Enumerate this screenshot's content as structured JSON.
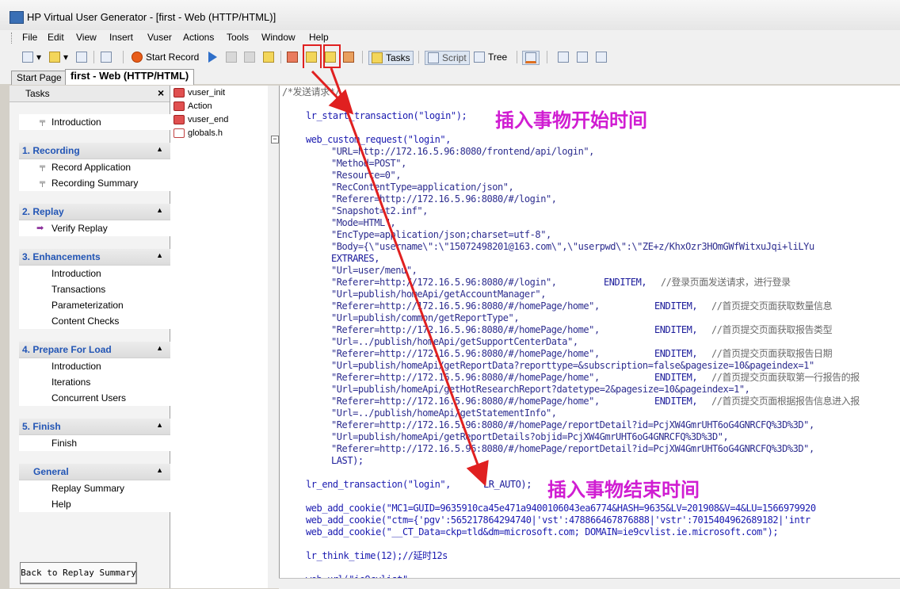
{
  "window": {
    "title": "HP Virtual User Generator - [first - Web (HTTP/HTML)]"
  },
  "menu": [
    "File",
    "Edit",
    "View",
    "Insert",
    "Vuser",
    "Actions",
    "Tools",
    "Window",
    "Help"
  ],
  "toolbar": {
    "start_record": "Start Record",
    "tasks": "Tasks",
    "script": "Script",
    "tree": "Tree"
  },
  "tabs": [
    "Start Page",
    "first - Web (HTTP/HTML)"
  ],
  "tasks_pane": {
    "title": "Tasks",
    "intro": "Introduction",
    "groups": [
      {
        "title": "1. Recording",
        "items": [
          "Record Application",
          "Recording Summary"
        ]
      },
      {
        "title": "2. Replay",
        "items": [
          "Verify Replay"
        ]
      },
      {
        "title": "3. Enhancements",
        "items": [
          "Introduction",
          "Transactions",
          "Parameterization",
          "Content Checks"
        ]
      },
      {
        "title": "4. Prepare For Load",
        "items": [
          "Introduction",
          "Iterations",
          "Concurrent Users"
        ]
      },
      {
        "title": "5. Finish",
        "items": [
          "Finish"
        ]
      },
      {
        "title": "General",
        "items": [
          "Replay Summary",
          "Help"
        ]
      }
    ],
    "back_button": "Back to Replay Summary"
  },
  "tree": [
    "vuser_init",
    "Action",
    "vuser_end",
    "globals.h"
  ],
  "code": {
    "l0": "/*发送请求*/",
    "l1": "lr_start_transaction(\"login\");",
    "l2": "web_custom_request(\"login\",",
    "l3": "\"URL=http://172.16.5.96:8080/frontend/api/login\",",
    "l4": "\"Method=POST\",",
    "l5": "\"Resource=0\",",
    "l6": "\"RecContentType=application/json\",",
    "l7": "\"Referer=http://172.16.5.96:8080/#/login\",",
    "l8": "\"Snapshot=t2.inf\",",
    "l9": "\"Mode=HTML\",",
    "l10": "\"EncType=application/json;charset=utf-8\",",
    "l11": "\"Body={\\\"username\\\":\\\"15072498201@163.com\\\",\\\"userpwd\\\":\\\"ZE+z/KhxOzr3HOmGWfWitxuJqi+liLYu",
    "l12": "EXTRARES,",
    "l13": "\"Url=user/menu\",",
    "l14a": "\"Referer=http://172.16.5.96:8080/#/login\",",
    "l14b": "ENDITEM,",
    "l14c": "//登录页面发送请求，进行登录",
    "l15": "\"Url=publish/homeApi/getAccountManager\",",
    "l16a": "\"Referer=http://172.16.5.96:8080/#/homePage/home\",",
    "l16b": "ENDITEM,",
    "l16c": "//首页提交页面获取数量信息",
    "l17": "\"Url=publish/common/getReportType\",",
    "l18a": "\"Referer=http://172.16.5.96:8080/#/homePage/home\",",
    "l18b": "ENDITEM,",
    "l18c": "//首页提交页面获取报告类型",
    "l19": "\"Url=../publish/homeApi/getSupportCenterData\",",
    "l20a": "\"Referer=http://172.16.5.96:8080/#/homePage/home\",",
    "l20b": "ENDITEM,",
    "l20c": "//首页提交页面获取报告日期",
    "l21": "\"Url=publish/homeApi/getReportData?reporttype=&subscription=false&pagesize=10&pageindex=1\"",
    "l22a": "\"Referer=http://172.16.5.96:8080/#/homePage/home\",",
    "l22b": "ENDITEM,",
    "l22c": "//首页提交页面获取第一行报告的报",
    "l23": "\"Url=publish/homeApi/getHotResearchReport?datetype=2&pagesize=10&pageindex=1\",",
    "l24a": "\"Referer=http://172.16.5.96:8080/#/homePage/home\",",
    "l24b": "ENDITEM,",
    "l24c": "//首页提交页面根据报告信息进入报",
    "l25": "\"Url=../publish/homeApi/getStatementInfo\",",
    "l26": "\"Referer=http://172.16.5.96:8080/#/homePage/reportDetail?id=PcjXW4GmrUHT6oG4GNRCFQ%3D%3D\",",
    "l27": "\"Url=publish/homeApi/getReportDetails?objid=PcjXW4GmrUHT6oG4GNRCFQ%3D%3D\",",
    "l28": "\"Referer=http://172.16.5.96:8080/#/homePage/reportDetail?id=PcjXW4GmrUHT6oG4GNRCFQ%3D%3D\",",
    "l29": "LAST);",
    "l30a": "lr_end_transaction(\"login\",",
    "l30b": "LR_AUTO);",
    "l31": "web_add_cookie(\"MC1=GUID=9635910ca45e471a9400106043ea6774&HASH=9635&LV=201908&V=4&LU=1566979920",
    "l32": "web_add_cookie(\"ctm={'pgv':565217864294740|'vst':478866467876888|'vstr':7015404962689182|'intr",
    "l33": "web_add_cookie(\"__CT_Data=ckp=tld&dm=microsoft.com; DOMAIN=ie9cvlist.ie.microsoft.com\");",
    "l34": "lr_think_time(12);//延时12s",
    "l35": "web_url(\"ie9cvlist\","
  },
  "annotations": {
    "start": "插入事物开始时间",
    "end": "插入事物结束时间"
  },
  "colors": {
    "annotation": "#d01dd2",
    "arrow": "#e02020",
    "highlight_box": "#e02020"
  }
}
